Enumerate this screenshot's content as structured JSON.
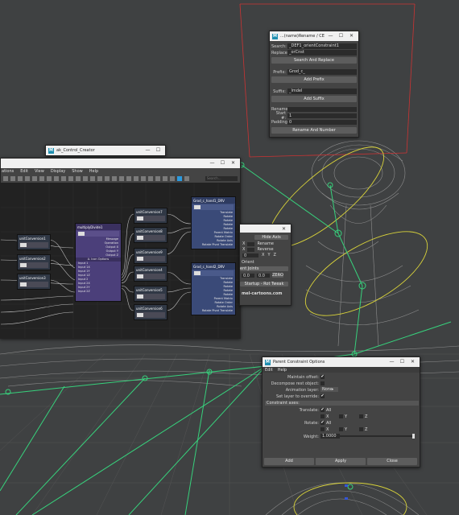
{
  "rename_window": {
    "title": "...(name)Rename / CE",
    "search_label": "Search:",
    "search_value": "_DEF1_orientConstraint1",
    "replace_label": "Replace:",
    "replace_value": "_orCnst",
    "search_replace_button": "Search And Replace",
    "prefix_label": "Prefix:",
    "prefix_value": "Grod_c_",
    "add_prefix_button": "Add Prefix",
    "suffix_label": "Suffix:",
    "suffix_value": "_lmdel",
    "add_suffix_button": "Add Suffix",
    "rename_label": "Rename:",
    "rename_value": "",
    "start_label": "Start #:",
    "start_value": "1",
    "padding_label": "Padding:",
    "padding_value": "0",
    "rename_number_button": "Rename And Number"
  },
  "control_creator": {
    "title": "ak_Control_Creator"
  },
  "node_editor": {
    "menu": [
      "ations",
      "Edit",
      "View",
      "Display",
      "Show",
      "Help"
    ],
    "search_placeholder": "Search...",
    "nodes": {
      "unit1": "unitConversion1",
      "unit2": "unitConversion2",
      "unit3": "unitConversion3",
      "multiply": "multiplyDivide1",
      "unit7": "unitConversion7",
      "unit8": "unitConversion8",
      "unit9": "unitConversion9",
      "unit4": "unitConversion4",
      "unit5": "unitConversion5",
      "unit6": "unitConversion6",
      "grod1": "Grod_c_hand1_DRV",
      "grod2": "Grod_c_hand2_DRV"
    },
    "multiply_ports": [
      "Message",
      "Operation",
      "Output X",
      "Output Y",
      "Output Z",
      "A. Icon Options",
      "Input 1",
      "Input 1X",
      "Input 1Y",
      "Input 1Z",
      "Input 2",
      "Input 2X",
      "Input 2Y",
      "Input 2Z"
    ],
    "transform_ports": [
      "Translate",
      "Rotate",
      "Rotate",
      "Rotate",
      "Rotate",
      "Parent Matrix",
      "Rotate Order",
      "Rotate Axis",
      "Rotate Pivot Translate"
    ]
  },
  "side_panel": {
    "hide_axis": "Hide Axis",
    "x": "X",
    "rename": "Rename",
    "reverse": "Reverse",
    "pos_row": [
      "0",
      "X",
      "Y",
      "Z"
    ],
    "orient_label": "Orient",
    "joints_label": "ent Joints",
    "vals": [
      "0.0",
      "0.0",
      "0.0"
    ],
    "zero_button": "ZERO",
    "twist_button": "Startup - Rot Tweak",
    "link": "mel-cartoons.com"
  },
  "parent_constraint": {
    "title": "Parent Constraint Options",
    "menu": [
      "Edit",
      "Help"
    ],
    "maintain_offset": "Maintain offset:",
    "decompose": "Decompose rest object:",
    "anim_layer": "Animation layer:",
    "anim_layer_value": "None",
    "set_layer": "Set layer to override:",
    "constraint_axes": "Constraint axes:",
    "translate": "Translate:",
    "rotate": "Rotate:",
    "all": "All",
    "x": "X",
    "y": "Y",
    "z": "Z",
    "weight": "Weight:",
    "weight_value": "1.0000",
    "add_button": "Add",
    "apply_button": "Apply",
    "close_button": "Close"
  }
}
